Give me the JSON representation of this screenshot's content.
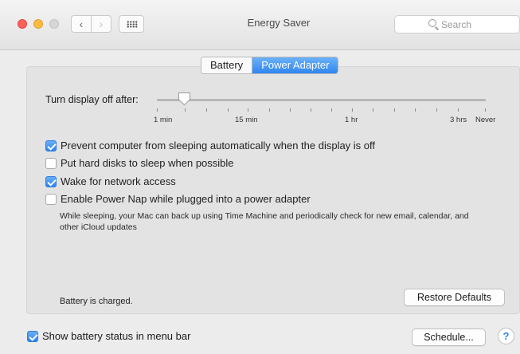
{
  "window": {
    "title": "Energy Saver"
  },
  "search": {
    "placeholder": "Search"
  },
  "tabs": [
    {
      "label": "Battery",
      "selected": false
    },
    {
      "label": "Power Adapter",
      "selected": true
    }
  ],
  "display_slider": {
    "label": "Turn display off after:",
    "tick_labels": [
      "1 min",
      "15 min",
      "1 hr",
      "3 hrs",
      "Never"
    ],
    "value": "2 min"
  },
  "options": [
    {
      "label": "Prevent computer from sleeping automatically when the display is off",
      "checked": true
    },
    {
      "label": "Put hard disks to sleep when possible",
      "checked": false
    },
    {
      "label": "Wake for network access",
      "checked": true
    },
    {
      "label": "Enable Power Nap while plugged into a power adapter",
      "checked": false
    }
  ],
  "power_nap_description": "While sleeping, your Mac can back up using Time Machine and periodically check for new email, calendar, and other iCloud updates",
  "status": "Battery is charged.",
  "buttons": {
    "restore_defaults": "Restore Defaults",
    "schedule": "Schedule...",
    "help": "?"
  },
  "bottom_option": {
    "label": "Show battery status in menu bar",
    "checked": true
  },
  "colors": {
    "accent": "#2e85ef"
  }
}
